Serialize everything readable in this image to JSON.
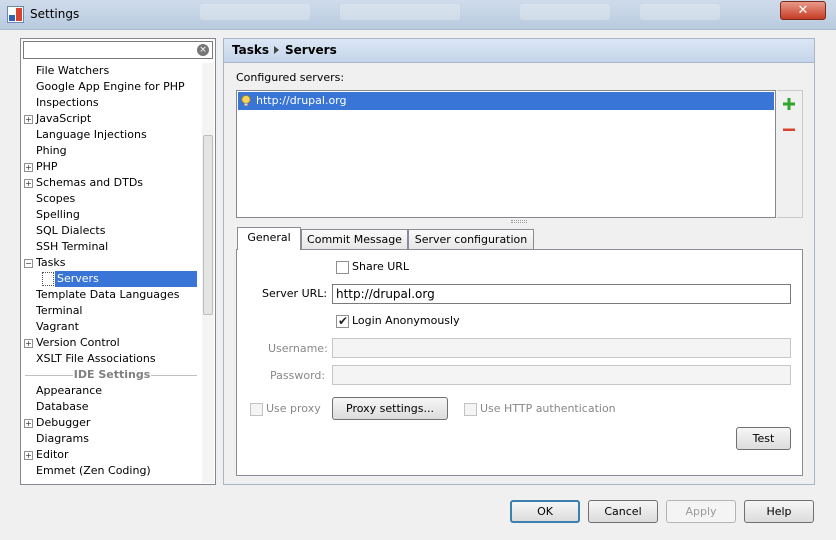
{
  "window": {
    "title": "Settings",
    "close_label": "✕"
  },
  "sidebar": {
    "search_placeholder": "",
    "items": [
      {
        "label": "File Watchers",
        "expandable": false
      },
      {
        "label": "Google App Engine for PHP",
        "expandable": false
      },
      {
        "label": "Inspections",
        "expandable": false
      },
      {
        "label": "JavaScript",
        "expandable": true,
        "expander": "+"
      },
      {
        "label": "Language Injections",
        "expandable": false
      },
      {
        "label": "Phing",
        "expandable": false
      },
      {
        "label": "PHP",
        "expandable": true,
        "expander": "+"
      },
      {
        "label": "Schemas and DTDs",
        "expandable": true,
        "expander": "+"
      },
      {
        "label": "Scopes",
        "expandable": false
      },
      {
        "label": "Spelling",
        "expandable": false
      },
      {
        "label": "SQL Dialects",
        "expandable": false
      },
      {
        "label": "SSH Terminal",
        "expandable": false
      },
      {
        "label": "Tasks",
        "expandable": true,
        "expander": "−"
      },
      {
        "label": "Servers",
        "expandable": false,
        "selected": true
      },
      {
        "label": "Template Data Languages",
        "expandable": false
      },
      {
        "label": "Terminal",
        "expandable": false
      },
      {
        "label": "Vagrant",
        "expandable": false
      },
      {
        "label": "Version Control",
        "expandable": true,
        "expander": "+"
      },
      {
        "label": "XSLT File Associations",
        "expandable": false
      }
    ],
    "ide_section": "IDE Settings",
    "ide_items": [
      {
        "label": "Appearance",
        "expandable": false
      },
      {
        "label": "Database",
        "expandable": false
      },
      {
        "label": "Debugger",
        "expandable": true,
        "expander": "+"
      },
      {
        "label": "Diagrams",
        "expandable": false
      },
      {
        "label": "Editor",
        "expandable": true,
        "expander": "+"
      },
      {
        "label": "Emmet (Zen Coding)",
        "expandable": false
      }
    ]
  },
  "breadcrumb": {
    "parent": "Tasks",
    "current": "Servers"
  },
  "servers": {
    "label": "Configured servers:",
    "items": [
      "http://drupal.org"
    ]
  },
  "tabs": [
    {
      "label": "General",
      "active": true
    },
    {
      "label": "Commit Message",
      "active": false
    },
    {
      "label": "Server configuration",
      "active": false
    }
  ],
  "general": {
    "share_url_label": "Share URL",
    "share_url_checked": false,
    "server_url_label": "Server URL:",
    "server_url_value": "http://drupal.org",
    "login_anon_label": "Login Anonymously",
    "login_anon_checked": true,
    "username_label": "Username:",
    "username_value": "",
    "password_label": "Password:",
    "password_value": "",
    "use_proxy_label": "Use proxy",
    "proxy_settings_label": "Proxy settings...",
    "http_auth_label": "Use HTTP authentication",
    "test_label": "Test"
  },
  "footer": {
    "ok_label": "OK",
    "cancel_label": "Cancel",
    "apply_label": "Apply",
    "help_label": "Help"
  },
  "colors": {
    "selection": "#3875d7",
    "add": "#2ea52e",
    "remove": "#d7432f"
  }
}
